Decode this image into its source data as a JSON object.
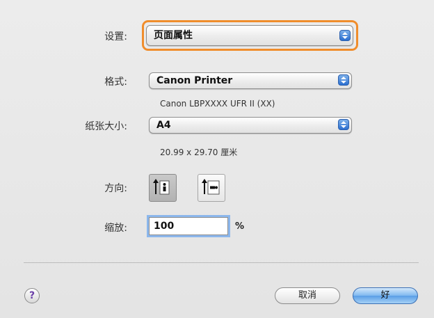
{
  "settings": {
    "label": "设置:",
    "value": "页面属性"
  },
  "format": {
    "label": "格式:",
    "value": "Canon Printer",
    "info": "Canon LBPXXXX UFR II (XX)"
  },
  "paper_size": {
    "label": "纸张大小:",
    "value": "A4",
    "info": "20.99 x 29.70 厘米"
  },
  "orientation": {
    "label": "方向:",
    "selected": "portrait"
  },
  "scale": {
    "label": "缩放:",
    "value": "100",
    "unit": "%"
  },
  "help": {
    "glyph": "?"
  },
  "buttons": {
    "cancel": "取消",
    "ok": "好"
  },
  "colors": {
    "focus_ring": "#f08d2c",
    "accent": "#2b6fd0",
    "default_button": "#7eb8ef"
  }
}
